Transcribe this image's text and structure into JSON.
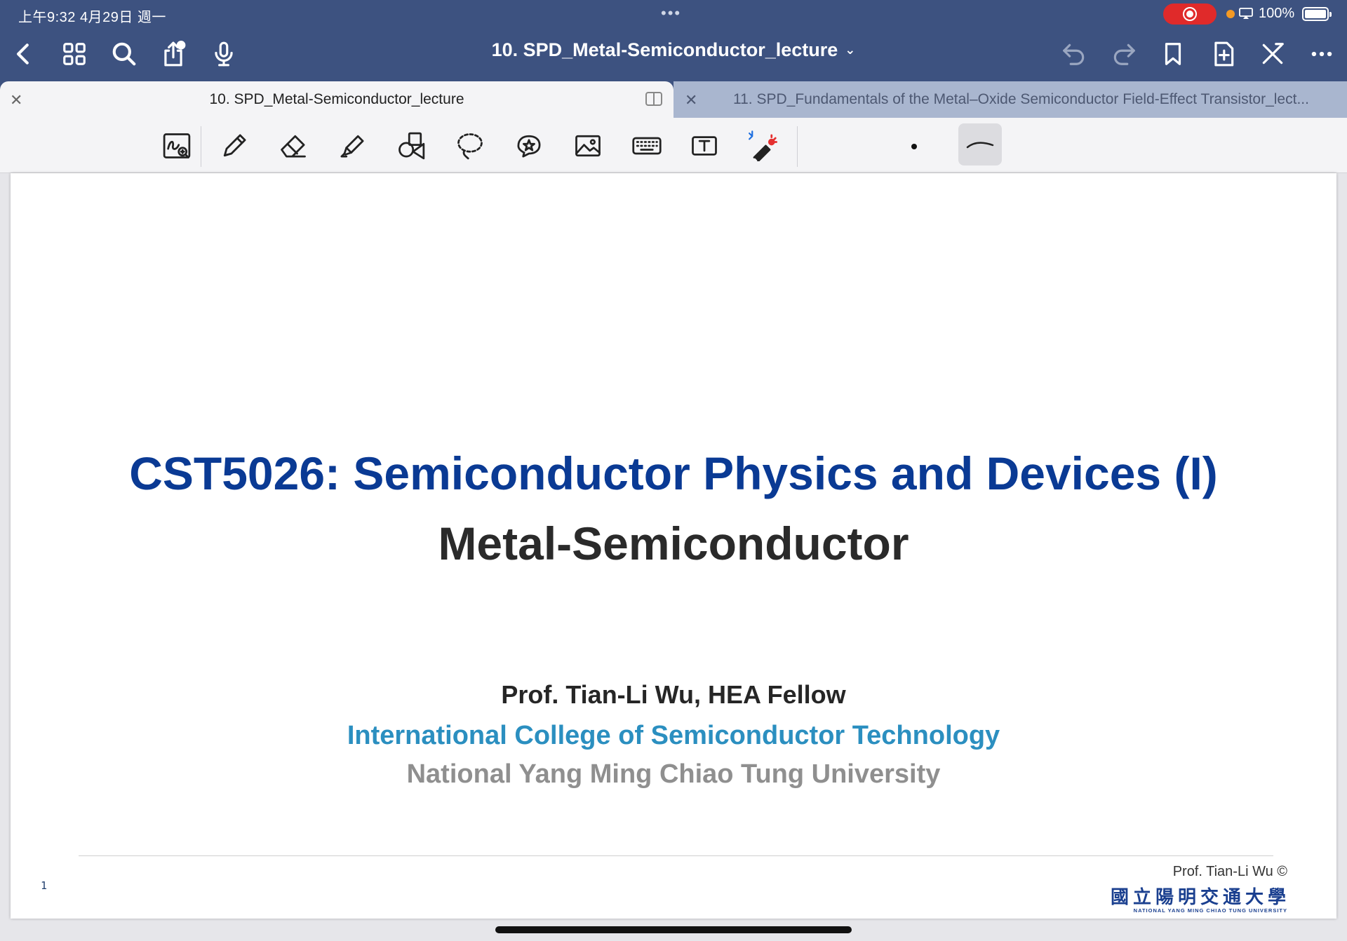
{
  "status_bar": {
    "time_date": "上午9:32   4月29日 週一",
    "battery": "100%"
  },
  "nav": {
    "document_title": "10. SPD_Metal-Semiconductor_lecture",
    "icons": [
      "back-icon",
      "grid-icon",
      "search-icon",
      "share-icon",
      "microphone-icon",
      "undo-icon",
      "redo-icon",
      "bookmark-icon",
      "add-page-icon",
      "close-edit-icon",
      "more-icon"
    ]
  },
  "tabs": [
    {
      "label": "10. SPD_Metal-Semiconductor_lecture",
      "active": true
    },
    {
      "label": "11. SPD_Fundamentals of the Metal–Oxide Semiconductor Field-Effect Transistor_lect...",
      "active": false
    }
  ],
  "tools": [
    "zoom-window-icon",
    "pen-icon",
    "eraser-icon",
    "highlighter-icon",
    "shapes-icon",
    "lasso-icon",
    "elements-icon",
    "image-icon",
    "keyboard-icon",
    "text-box-icon",
    "laser-pointer-icon"
  ],
  "colors": {
    "nav_bg": "#3d5280",
    "title_blue": "#0a3a94",
    "college_blue": "#2b8fc0",
    "univ_gray": "#8f8f8f"
  },
  "slide": {
    "title_line1": "CST5026: Semiconductor Physics and Devices (I)",
    "title_line2": "Metal-Semiconductor",
    "author": "Prof. Tian-Li Wu, HEA Fellow",
    "college": "International College of Semiconductor Technology",
    "university": "National Yang Ming Chiao Tung University",
    "page_number": "1",
    "copyright": "Prof. Tian-Li Wu ©",
    "logo_chinese": "國立陽明交通大學",
    "logo_english": "NATIONAL YANG MING CHIAO TUNG UNIVERSITY"
  }
}
